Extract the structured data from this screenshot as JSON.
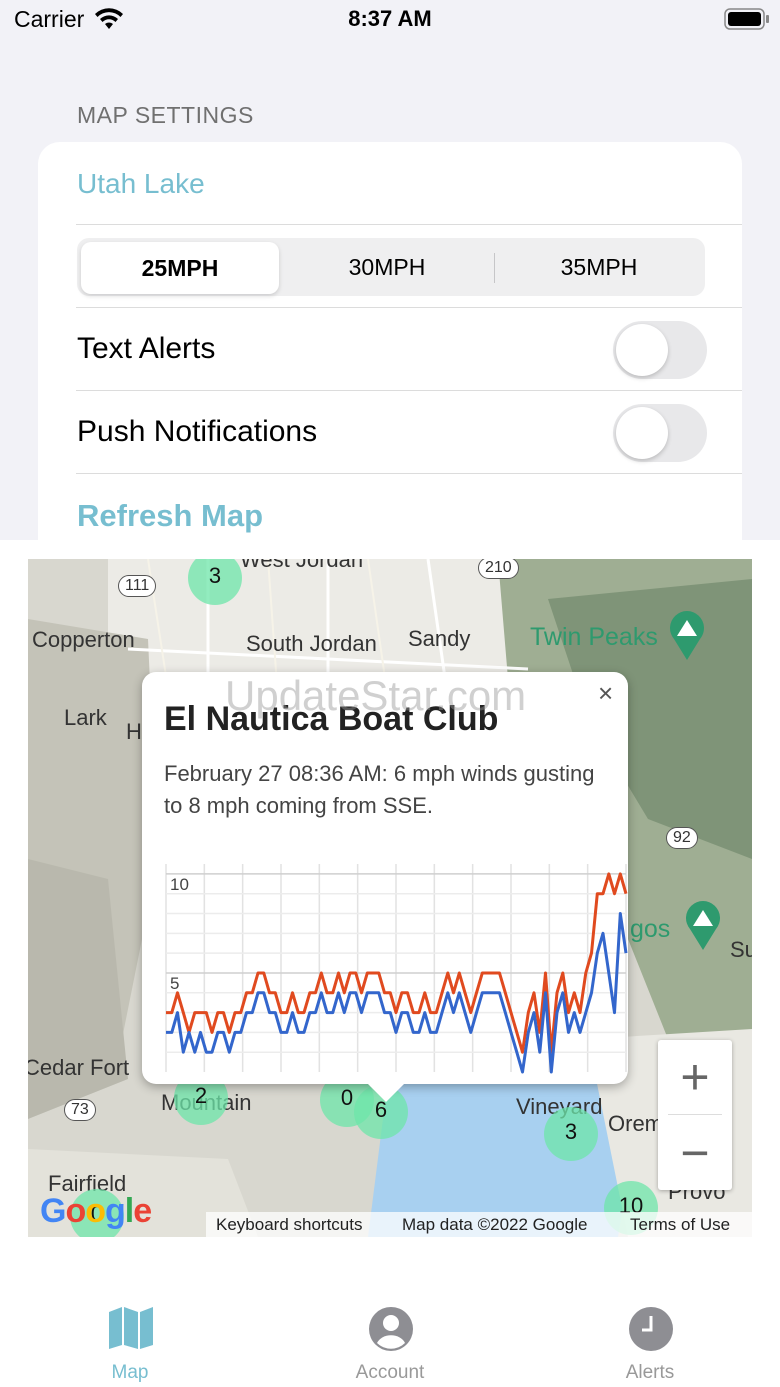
{
  "status_bar": {
    "carrier": "Carrier",
    "time": "8:37 AM"
  },
  "settings": {
    "section_title": "MAP SETTINGS",
    "lake": "Utah Lake",
    "speeds": [
      "25MPH",
      "30MPH",
      "35MPH"
    ],
    "selected_speed": "25MPH",
    "text_alerts_label": "Text Alerts",
    "text_alerts_on": false,
    "push_label": "Push Notifications",
    "push_on": false,
    "refresh_label": "Refresh Map"
  },
  "map": {
    "places": [
      "West Jordan",
      "Copperton",
      "South Jordan",
      "Sandy",
      "Twin Peaks",
      "Lark",
      "H",
      "Cedar Fort",
      "Mountain",
      "Vineyard",
      "Orem",
      "Fairfield",
      "Provo",
      "gos",
      "Su"
    ],
    "routes": [
      "111",
      "210",
      "92",
      "73"
    ],
    "stations": [
      "3",
      "2",
      "0",
      "6",
      "3",
      "0",
      "10"
    ],
    "zoom_in": "+",
    "zoom_out": "−",
    "google_logo": "Google",
    "attribution": {
      "shortcuts": "Keyboard shortcuts",
      "data": "Map data ©2022 Google",
      "terms": "Terms of Use"
    },
    "watermark": "UpdateStar.com"
  },
  "info_window": {
    "title": "El Nautica Boat Club",
    "text": "February 27 08:36 AM: 6 mph winds gusting to 8 mph coming from SSE.",
    "close": "×"
  },
  "chart_data": {
    "type": "line",
    "ylim": [
      0,
      10.5
    ],
    "yticks": [
      "10",
      "5"
    ],
    "series": [
      {
        "color": "#e04a1f",
        "values": [
          3,
          3,
          4,
          3,
          2,
          3,
          3,
          3,
          2,
          3,
          3,
          2,
          3,
          3,
          4,
          4,
          5,
          5,
          4,
          4,
          3,
          3,
          4,
          3,
          3,
          4,
          4,
          5,
          4,
          4,
          5,
          4,
          5,
          5,
          4,
          5,
          5,
          5,
          4,
          4,
          3,
          4,
          4,
          3,
          3,
          4,
          3,
          3,
          4,
          5,
          4,
          5,
          4,
          3,
          4,
          5,
          5,
          5,
          5,
          4,
          3,
          2,
          1,
          3,
          4,
          2,
          5,
          1,
          4,
          5,
          3,
          4,
          3,
          5,
          6,
          9,
          9,
          10,
          9,
          10,
          9
        ]
      },
      {
        "color": "#3366cc",
        "values": [
          2,
          2,
          3,
          1,
          2,
          1,
          2,
          1,
          1,
          2,
          2,
          1,
          2,
          2,
          3,
          3,
          4,
          4,
          3,
          3,
          2,
          2,
          3,
          2,
          2,
          3,
          3,
          4,
          3,
          3,
          4,
          3,
          4,
          4,
          3,
          4,
          4,
          4,
          3,
          3,
          2,
          3,
          3,
          2,
          2,
          3,
          2,
          2,
          3,
          4,
          3,
          4,
          3,
          2,
          3,
          4,
          4,
          4,
          4,
          3,
          2,
          1,
          0,
          2,
          3,
          1,
          4,
          0,
          3,
          4,
          2,
          3,
          2,
          3,
          4,
          6,
          7,
          5,
          3,
          8,
          6
        ]
      }
    ]
  },
  "tabs": [
    {
      "label": "Map",
      "icon": "map-icon",
      "active": true
    },
    {
      "label": "Account",
      "icon": "account-icon",
      "active": false
    },
    {
      "label": "Alerts",
      "icon": "clock-icon",
      "active": false
    }
  ],
  "colors": {
    "accent": "#77bed0",
    "gust": "#e04a1f",
    "wind": "#3366cc"
  }
}
